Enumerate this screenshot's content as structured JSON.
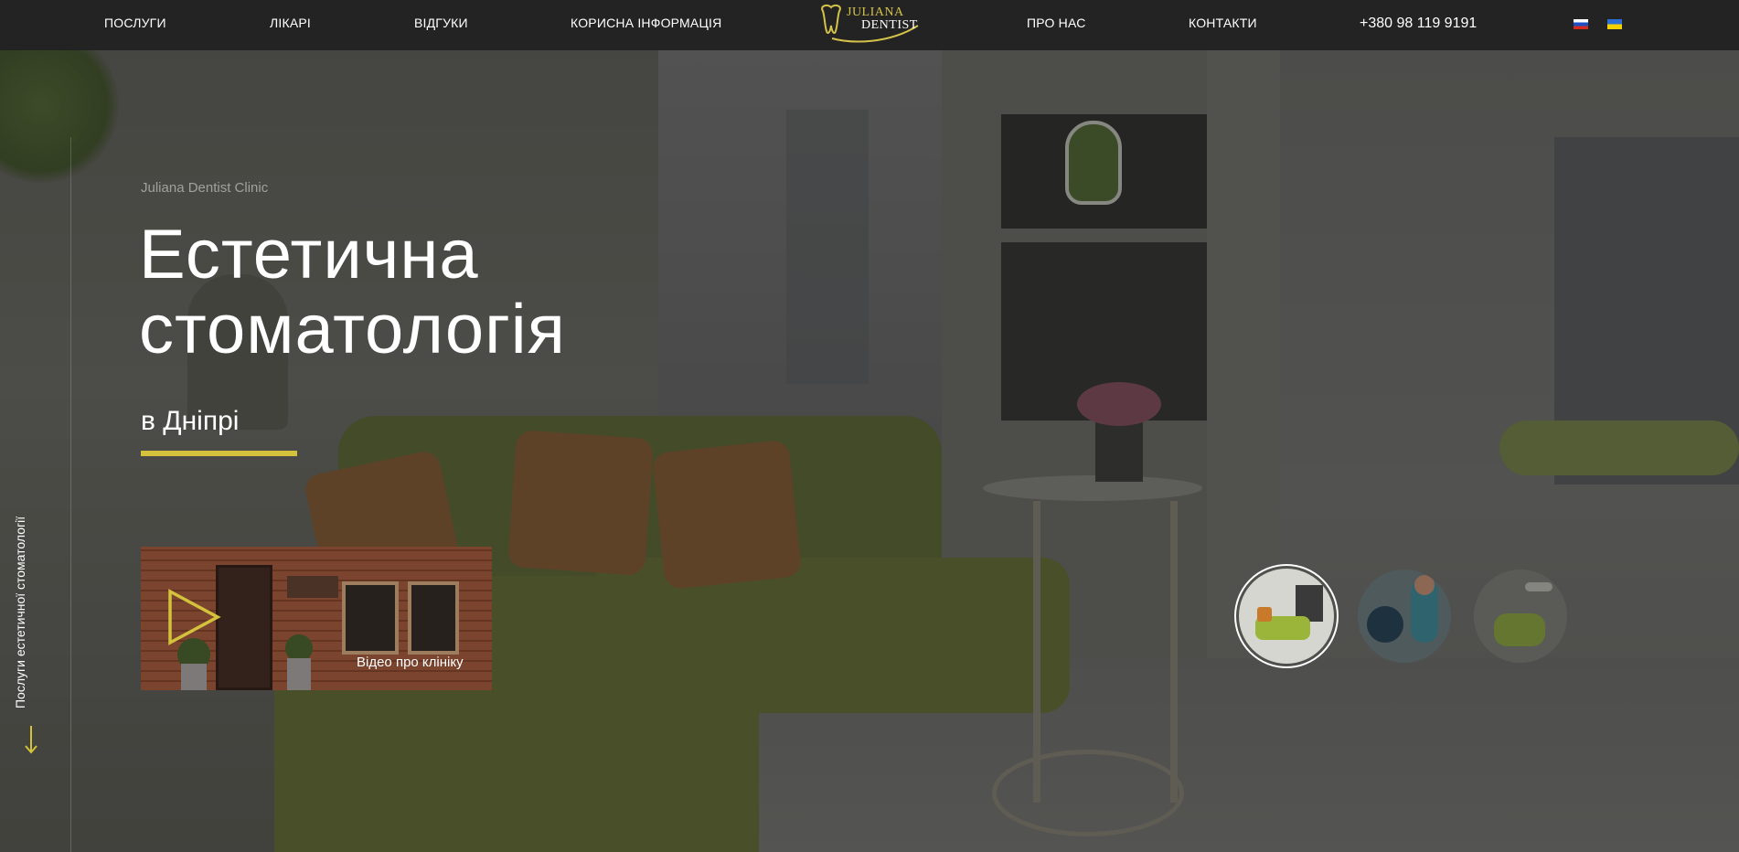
{
  "header": {
    "nav_left": [
      "ПОСЛУГИ",
      "ЛІКАРІ",
      "ВІДГУКИ",
      "КОРИСНА ІНФОРМАЦІЯ"
    ],
    "nav_right": [
      "ПРО НАС",
      "КОНТАКТИ"
    ],
    "phone": "+380 98 119 9191",
    "logo": {
      "line1": "JULIANA",
      "line2": "DENTIST"
    },
    "flags": [
      "ru-flag-icon",
      "ua-flag-icon"
    ]
  },
  "hero": {
    "eyebrow": "Juliana Dentist Clinic",
    "title_line1": "Естетична",
    "title_line2": "стоматологія",
    "city": "в Дніпрі",
    "video_label": "Відео про клініку"
  },
  "side": {
    "label": "Послуги естетичної стоматології",
    "arrow_icon": "arrow-down-icon"
  },
  "thumbnails": {
    "count": 3,
    "active_index": 0
  },
  "colors": {
    "accent": "#d4c23c",
    "header_bg": "#232323",
    "text": "#ffffff"
  }
}
